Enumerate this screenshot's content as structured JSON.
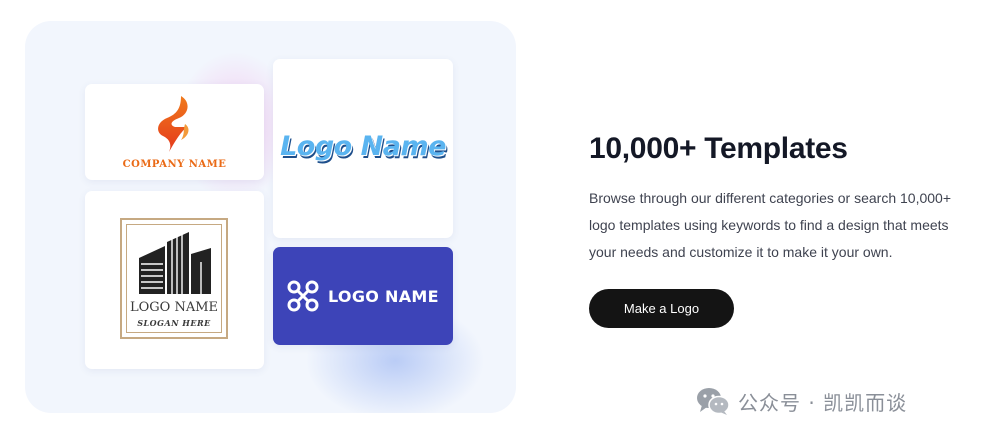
{
  "showcase": {
    "company_logo": {
      "text": "COMPANY NAME",
      "icon": "flame-icon",
      "color": "#ea6a16"
    },
    "script_logo": {
      "text": "Logo Name",
      "color": "#5ab4f0"
    },
    "building_logo": {
      "icon": "building-icon",
      "title": "LOGO NAME",
      "slogan": "SLOGAN HERE",
      "frame_color": "#c6a982"
    },
    "drone_logo": {
      "icon": "drone-icon",
      "text": "LOGO NAME",
      "background": "#3d44b8"
    }
  },
  "content": {
    "headline": "10,000+ Templates",
    "description": "Browse through our different categories or search 10,000+ logo templates using keywords to find a design that meets your needs and customize it to make it your own.",
    "cta_label": "Make a Logo"
  },
  "watermark": {
    "icon": "wechat-icon",
    "text": "公众号 · 凯凯而谈"
  }
}
